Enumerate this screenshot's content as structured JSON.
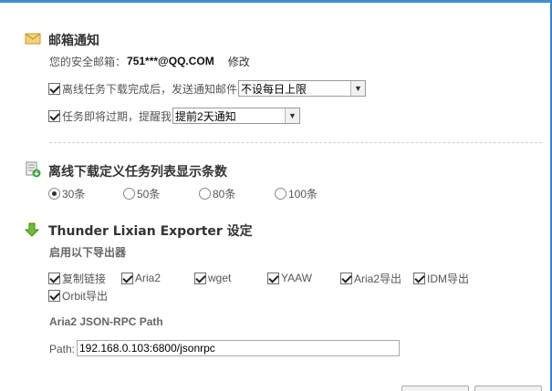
{
  "email_section": {
    "title": "邮箱通知",
    "icon": "envelope-icon",
    "safe_email_label": "您的安全邮箱：",
    "email": "751***@QQ.COM",
    "edit_link": "修改",
    "offline_notify": {
      "label": "离线任务下载完成后，发送通知邮件",
      "checked": true,
      "select_value": "不设每日上限"
    },
    "expire_remind": {
      "label": "任务即将过期，提醒我",
      "checked": true,
      "select_value": "提前2天通知"
    }
  },
  "list_section": {
    "title": "离线下载定义任务列表显示条数",
    "icon": "download-list-icon",
    "options": [
      {
        "label": "30条",
        "checked": true
      },
      {
        "label": "50条",
        "checked": false
      },
      {
        "label": "80条",
        "checked": false
      },
      {
        "label": "100条",
        "checked": false
      }
    ]
  },
  "exporter_section": {
    "title": "Thunder Lixian Exporter 设定",
    "icon": "green-down-arrow-icon",
    "enable_label": "启用以下导出器",
    "exporters": [
      {
        "label": "复制链接",
        "checked": true
      },
      {
        "label": "Aria2",
        "checked": true
      },
      {
        "label": "wget",
        "checked": true
      },
      {
        "label": "YAAW",
        "checked": true
      },
      {
        "label": "Aria2导出",
        "checked": true
      },
      {
        "label": "IDM导出",
        "checked": true
      },
      {
        "label": "Orbit导出",
        "checked": true
      }
    ],
    "rpc_title": "Aria2 JSON-RPC Path",
    "path_label": "Path:",
    "path_value": "192.168.0.103:6800/jsonrpc"
  },
  "colors": {
    "accent": "#3a8fd6",
    "title_text": "#333333",
    "body_text": "#555555"
  }
}
